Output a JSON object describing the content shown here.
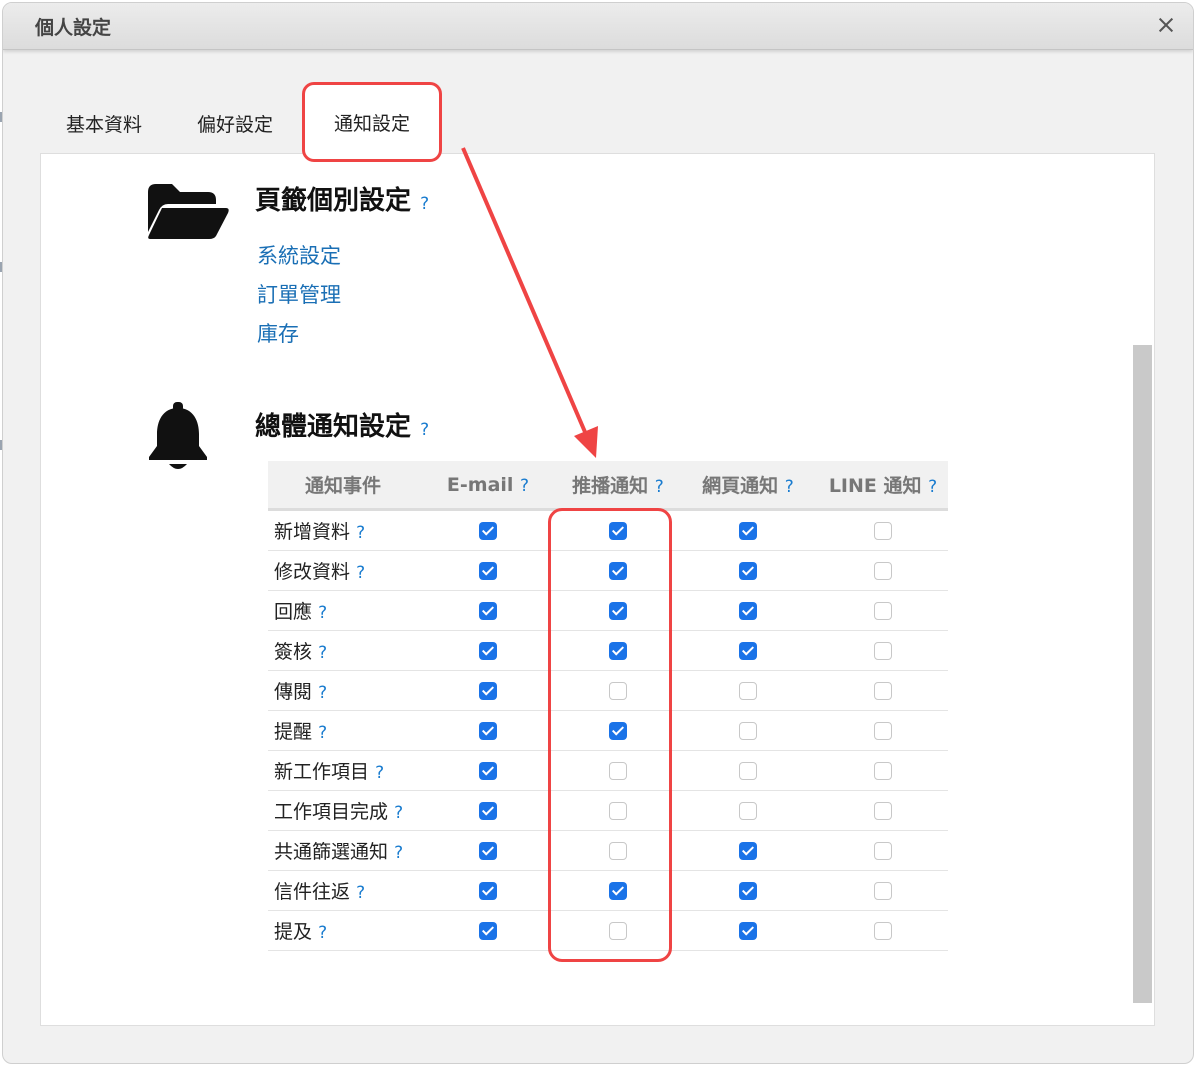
{
  "dialog": {
    "title": "個人設定",
    "close_icon": "close-icon"
  },
  "tabs": [
    {
      "label": "基本資料",
      "active": false
    },
    {
      "label": "偏好設定",
      "active": false
    },
    {
      "label": "通知設定",
      "active": true
    }
  ],
  "tab_settings": {
    "title": "頁籤個別設定",
    "help": "?",
    "icon": "folder-open-icon",
    "links": [
      "系統設定",
      "訂單管理",
      "庫存"
    ]
  },
  "global_notifications": {
    "title": "總體通知設定",
    "help": "?",
    "icon": "bell-icon",
    "columns": [
      {
        "label": "通知事件",
        "help": ""
      },
      {
        "label": "E-mail",
        "help": "?"
      },
      {
        "label": "推播通知",
        "help": "?"
      },
      {
        "label": "網頁通知",
        "help": "?"
      },
      {
        "label": "LINE 通知",
        "help": "?"
      }
    ],
    "rows": [
      {
        "event": "新增資料",
        "help": "?",
        "email": true,
        "push": true,
        "web": true,
        "line": false
      },
      {
        "event": "修改資料",
        "help": "?",
        "email": true,
        "push": true,
        "web": true,
        "line": false
      },
      {
        "event": "回應",
        "help": "?",
        "email": true,
        "push": true,
        "web": true,
        "line": false
      },
      {
        "event": "簽核",
        "help": "?",
        "email": true,
        "push": true,
        "web": true,
        "line": false
      },
      {
        "event": "傳閱",
        "help": "?",
        "email": true,
        "push": false,
        "web": false,
        "line": false
      },
      {
        "event": "提醒",
        "help": "?",
        "email": true,
        "push": true,
        "web": false,
        "line": false
      },
      {
        "event": "新工作項目",
        "help": "?",
        "email": true,
        "push": false,
        "web": false,
        "line": false
      },
      {
        "event": "工作項目完成",
        "help": "?",
        "email": true,
        "push": false,
        "web": false,
        "line": false
      },
      {
        "event": "共通篩選通知",
        "help": "?",
        "email": true,
        "push": false,
        "web": true,
        "line": false
      },
      {
        "event": "信件往返",
        "help": "?",
        "email": true,
        "push": true,
        "web": true,
        "line": false
      },
      {
        "event": "提及",
        "help": "?",
        "email": true,
        "push": false,
        "web": true,
        "line": false
      }
    ]
  },
  "colors": {
    "highlight": "#ef4444",
    "checkbox_on": "#1a73e8",
    "link": "#1a6fb5",
    "help": "#1a7ccf"
  }
}
